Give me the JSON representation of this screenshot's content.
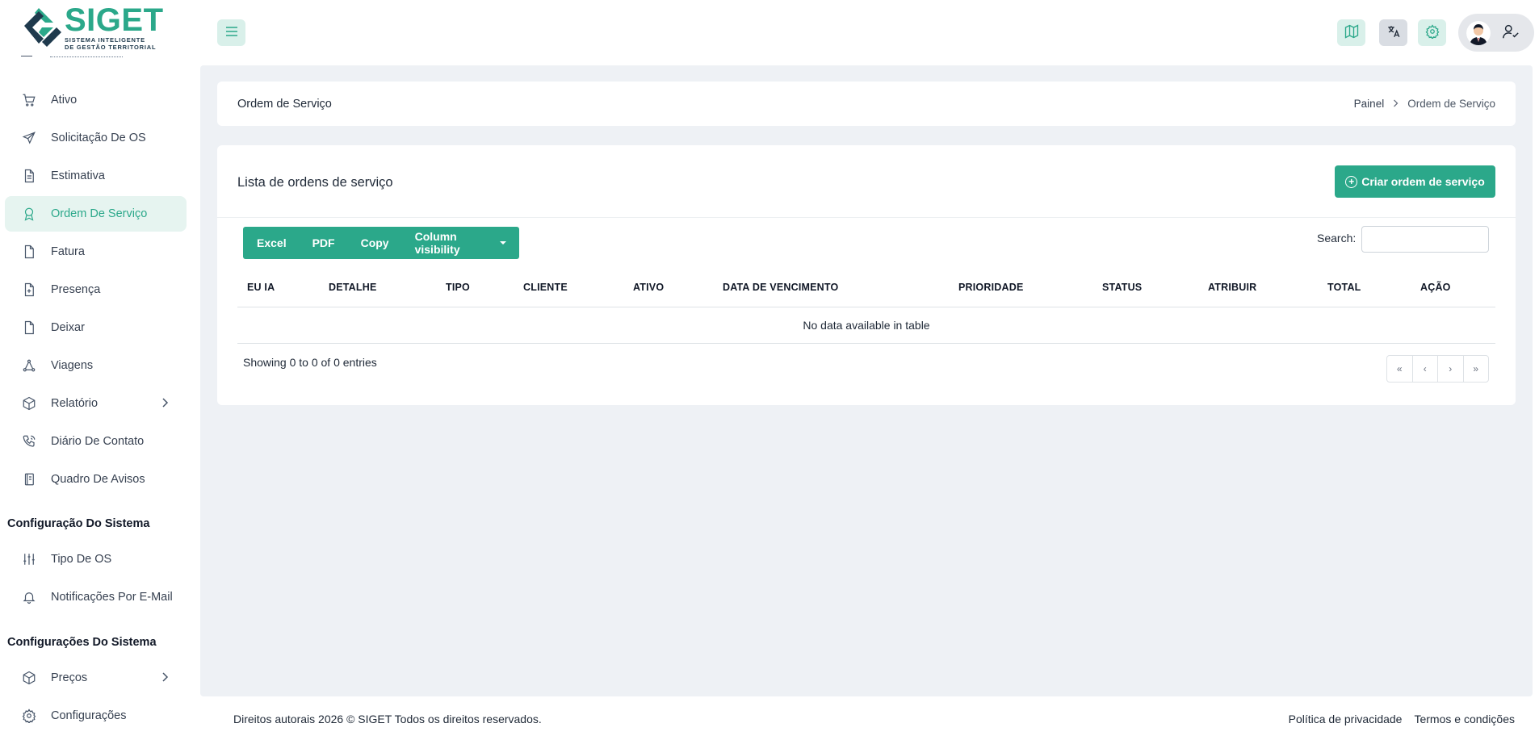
{
  "brand": {
    "name": "SIGET",
    "subtitle_line1": "SISTEMA INTELIGENTE",
    "subtitle_line2": "DE GESTÃO TERRITORIAL",
    "accent": "#2ba88a",
    "accent_light": "#e6f4f0"
  },
  "sidebar": {
    "items": [
      {
        "label": "Ativo",
        "icon": "cart-icon"
      },
      {
        "label": "Solicitação De OS",
        "icon": "send-icon"
      },
      {
        "label": "Estimativa",
        "icon": "document-icon"
      },
      {
        "label": "Ordem De Serviço",
        "icon": "award-icon",
        "active": true
      },
      {
        "label": "Fatura",
        "icon": "file-icon"
      },
      {
        "label": "Presença",
        "icon": "file-plus-icon"
      },
      {
        "label": "Deixar",
        "icon": "file-icon"
      },
      {
        "label": "Viagens",
        "icon": "share-nodes-icon"
      },
      {
        "label": "Relatório",
        "icon": "box-icon",
        "has_children": true
      },
      {
        "label": "Diário De Contato",
        "icon": "phone-icon"
      },
      {
        "label": "Quadro De Avisos",
        "icon": "notebook-icon"
      }
    ],
    "section1": "Configuração Do Sistema",
    "section1_items": [
      {
        "label": "Tipo De OS",
        "icon": "sliders-icon"
      },
      {
        "label": "Notificações Por E-Mail",
        "icon": "bell-icon"
      }
    ],
    "section2": "Configurações Do Sistema",
    "section2_items": [
      {
        "label": "Preços",
        "icon": "box-icon",
        "has_children": true
      },
      {
        "label": "Configurações",
        "icon": "gear-icon"
      }
    ]
  },
  "breadcrumb": {
    "title": "Ordem de Serviço",
    "home": "Painel",
    "current": "Ordem de Serviço"
  },
  "list": {
    "title": "Lista de ordens de serviço",
    "create_label": "Criar ordem de serviço",
    "buttons": {
      "excel": "Excel",
      "pdf": "PDF",
      "copy": "Copy",
      "column_visibility": "Column visibility"
    },
    "search_label": "Search:",
    "search_value": "",
    "columns": [
      "EU IA",
      "DETALHE",
      "TIPO",
      "CLIENTE",
      "ATIVO",
      "DATA DE VENCIMENTO",
      "PRIORIDADE",
      "STATUS",
      "ATRIBUIR",
      "TOTAL",
      "AÇÃO"
    ],
    "empty_message": "No data available in table",
    "info": "Showing 0 to 0 of 0 entries",
    "pager": [
      "«",
      "‹",
      "›",
      "»"
    ]
  },
  "footer": {
    "copyright": "Direitos autorais 2026 © SIGET Todos os direitos reservados.",
    "privacy": "Política de privacidade",
    "terms": "Termos e condições"
  }
}
